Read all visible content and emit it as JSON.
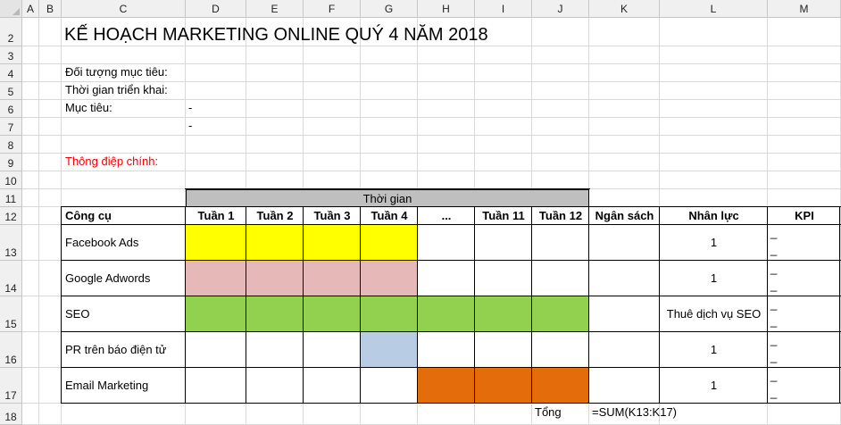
{
  "columns": [
    "A",
    "B",
    "C",
    "D",
    "E",
    "F",
    "G",
    "H",
    "I",
    "J",
    "K",
    "L",
    "M"
  ],
  "rows": [
    "2",
    "3",
    "4",
    "5",
    "6",
    "7",
    "8",
    "9",
    "10",
    "11",
    "12",
    "13",
    "14",
    "15",
    "16",
    "17",
    "18"
  ],
  "sheet": {
    "title": "KẾ HOẠCH MARKETING ONLINE QUÝ 4 NĂM 2018",
    "label_target": "Đối tượng mục tiêu:",
    "label_time": "Thời gian triển khai:",
    "label_goal": "Mục tiêu:",
    "goal_dash_1": "-",
    "goal_dash_2": "-",
    "label_message": "Thông điệp chính:",
    "time_header": "Thời gian",
    "total_label": "Tổng",
    "total_formula": "=SUM(K13:K17)"
  },
  "table": {
    "headers": [
      "Công cụ",
      "Tuần 1",
      "Tuần 2",
      "Tuần 3",
      "Tuần 4",
      "...",
      "Tuần 11",
      "Tuần 12",
      "Ngân sách",
      "Nhân lực",
      "KPI"
    ],
    "rows": [
      {
        "tool": "Facebook Ads",
        "staff": "1",
        "fills": [
          "#ffff00",
          "#ffff00",
          "#ffff00",
          "#ffff00",
          "",
          "",
          ""
        ]
      },
      {
        "tool": "Google Adwords",
        "staff": "1",
        "fills": [
          "#e6b8b7",
          "#e6b8b7",
          "#e6b8b7",
          "#e6b8b7",
          "",
          "",
          ""
        ]
      },
      {
        "tool": "SEO",
        "staff": "Thuê dịch vụ SEO",
        "fills": [
          "#92d050",
          "#92d050",
          "#92d050",
          "#92d050",
          "#92d050",
          "#92d050",
          "#92d050"
        ]
      },
      {
        "tool": "PR trên báo điện tử",
        "staff": "1",
        "fills": [
          "",
          "",
          "",
          "#b8cce4",
          "",
          "",
          ""
        ]
      },
      {
        "tool": "Email Marketing",
        "staff": "1",
        "fills": [
          "",
          "",
          "",
          "",
          "#e46c0a",
          "#e46c0a",
          "#e46c0a"
        ]
      }
    ],
    "kpi_marks": [
      "_",
      "_"
    ]
  },
  "colors": {
    "title_red": "#ff0000",
    "header_gray": "#bfbfbf"
  }
}
